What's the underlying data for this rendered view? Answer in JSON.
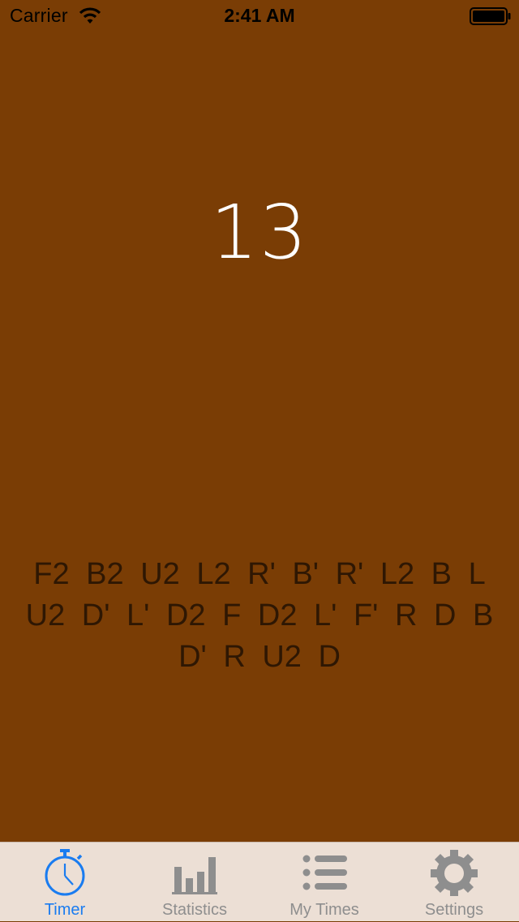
{
  "status_bar": {
    "carrier": "Carrier",
    "time": "2:41 AM"
  },
  "timer": {
    "value": "13"
  },
  "scramble": {
    "text": "F2 B2 U2 L2 R' B' R' L2 B L U2 D' L' D2 F D2 L' F' R D B D' R U2 D"
  },
  "tab_bar": {
    "active_color": "#1a7cf0",
    "inactive_color": "#8e8e8e",
    "tabs": [
      {
        "label": "Timer",
        "icon": "stopwatch-icon",
        "active": true
      },
      {
        "label": "Statistics",
        "icon": "bar-chart-icon",
        "active": false
      },
      {
        "label": "My Times",
        "icon": "list-icon",
        "active": false
      },
      {
        "label": "Settings",
        "icon": "gear-icon",
        "active": false
      }
    ]
  },
  "colors": {
    "background": "#7a3d05",
    "tab_bar_background": "#ecdfd5"
  }
}
